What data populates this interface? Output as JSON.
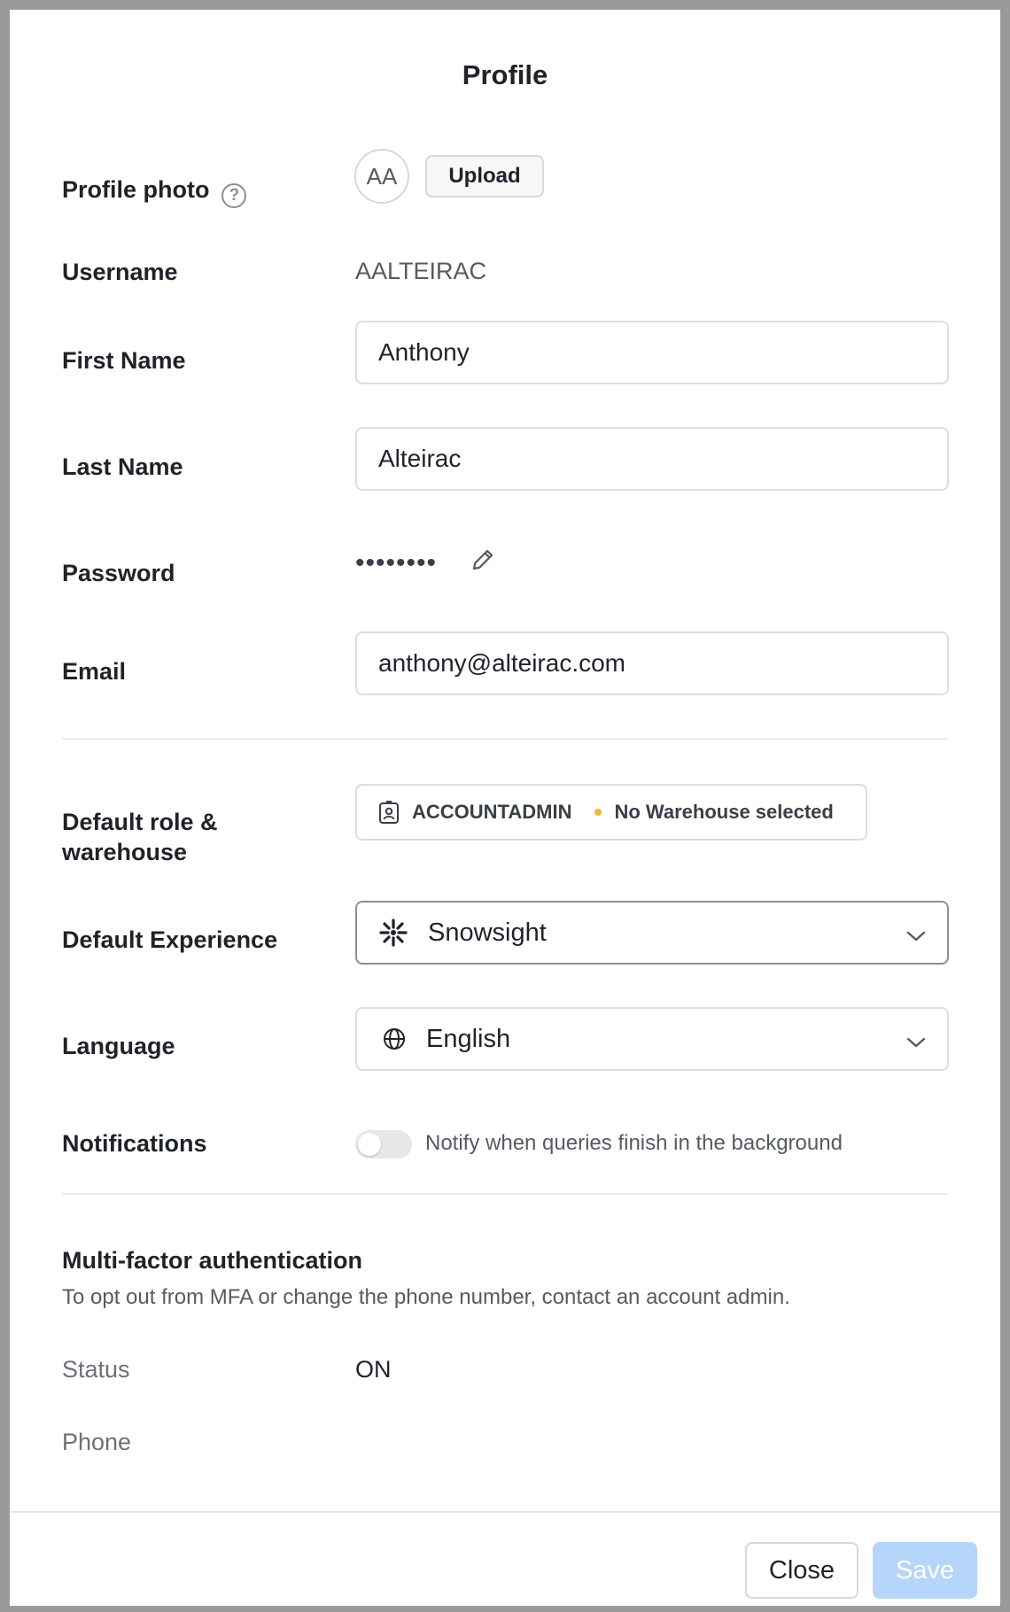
{
  "dialog": {
    "title": "Profile"
  },
  "profile_photo": {
    "label": "Profile photo",
    "help_glyph": "?",
    "avatar_initials": "AA",
    "upload_label": "Upload"
  },
  "username": {
    "label": "Username",
    "value": "AALTEIRAC"
  },
  "first_name": {
    "label": "First Name",
    "value": "Anthony"
  },
  "last_name": {
    "label": "Last Name",
    "value": "Alteirac"
  },
  "password": {
    "label": "Password",
    "masked_value": "••••••••",
    "edit_icon": "pencil-icon"
  },
  "email": {
    "label": "Email",
    "value": "anthony@alteirac.com"
  },
  "default_role": {
    "label_line1": "Default role &",
    "label_line2": "warehouse",
    "role": "ACCOUNTADMIN",
    "warehouse": "No Warehouse selected",
    "status_dot_color": "#f5b731",
    "icon": "badge-icon"
  },
  "default_experience": {
    "label": "Default Experience",
    "value": "Snowsight",
    "icon": "snowflake-icon"
  },
  "language": {
    "label": "Language",
    "value": "English",
    "icon": "globe-icon"
  },
  "notifications": {
    "label": "Notifications",
    "toggle_on": false,
    "description": "Notify when queries finish in the background"
  },
  "mfa": {
    "heading": "Multi-factor authentication",
    "description": "To opt out from MFA or change the phone number, contact an account admin.",
    "status_label": "Status",
    "status_value": "ON",
    "phone_label": "Phone"
  },
  "footer": {
    "close_label": "Close",
    "save_label": "Save",
    "save_color": "#b6d5fb"
  }
}
